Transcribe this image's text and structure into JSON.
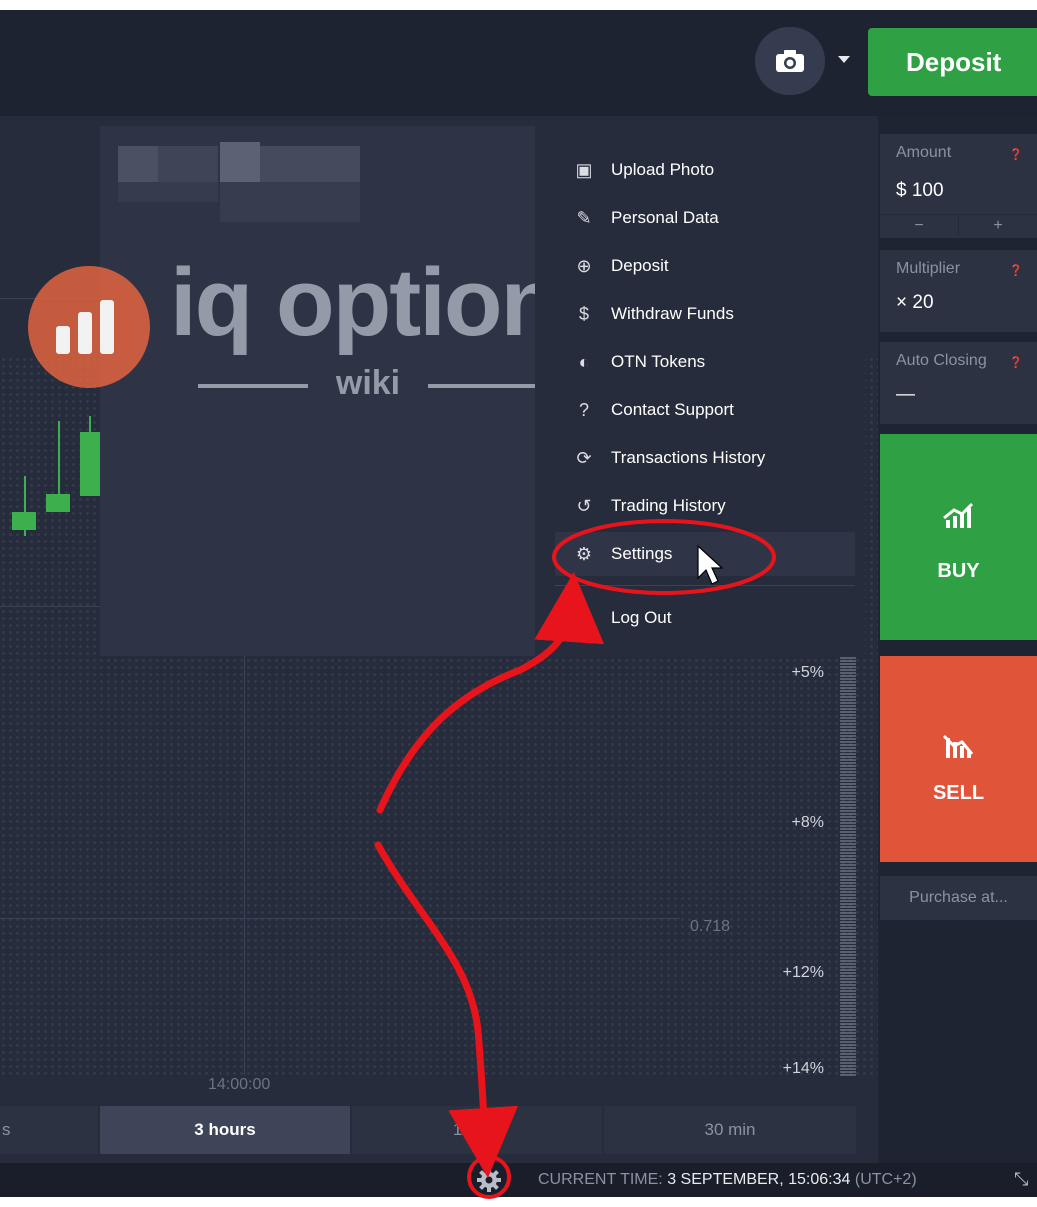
{
  "topbar": {
    "camera_icon": "camera-icon",
    "deposit_label": "Deposit",
    "accent": "#2fa043"
  },
  "user_menu": {
    "items": [
      {
        "label": "Upload Photo",
        "icon": "camera-icon"
      },
      {
        "label": "Personal Data",
        "icon": "edit-icon"
      },
      {
        "label": "Deposit",
        "icon": "plus-circle-icon"
      },
      {
        "label": "Withdraw Funds",
        "icon": "dollar-icon"
      },
      {
        "label": "OTN Tokens",
        "icon": "token-icon"
      },
      {
        "label": "Contact Support",
        "icon": "question-icon"
      },
      {
        "label": "Transactions History",
        "icon": "refresh-icon"
      },
      {
        "label": "Trading History",
        "icon": "history-icon"
      },
      {
        "label": "Settings",
        "icon": "gear-icon",
        "highlighted": true
      }
    ],
    "logout_label": "Log Out"
  },
  "side_panel": {
    "amount_label": "Amount",
    "amount_value": "$ 100",
    "minus": "−",
    "plus": "+",
    "multiplier_label": "Multiplier",
    "multiplier_value": "× 20",
    "auto_closing_label": "Auto Closing",
    "auto_closing_value": "—",
    "buy_label": "BUY",
    "sell_label": "SELL",
    "purchase_label": "Purchase at...",
    "buy_color": "#2fa043",
    "sell_color": "#e0553a"
  },
  "chart": {
    "scale_labels": [
      "+5%",
      "+8%",
      "+12%",
      "+14%"
    ],
    "price": "0.718",
    "time": "14:00:00"
  },
  "timeframes": [
    {
      "label": "s",
      "active": false
    },
    {
      "label": "3 hours",
      "active": true
    },
    {
      "label": "1 hour",
      "active": false
    },
    {
      "label": "30 min",
      "active": false
    }
  ],
  "status_bar": {
    "prefix": "CURRENT TIME:",
    "datetime": "3 SEPTEMBER, 15:06:34",
    "tz": "(UTC+2)"
  },
  "watermark": {
    "brand": "iq option",
    "sub": "wiki"
  },
  "annotation_color": "#e8141b"
}
